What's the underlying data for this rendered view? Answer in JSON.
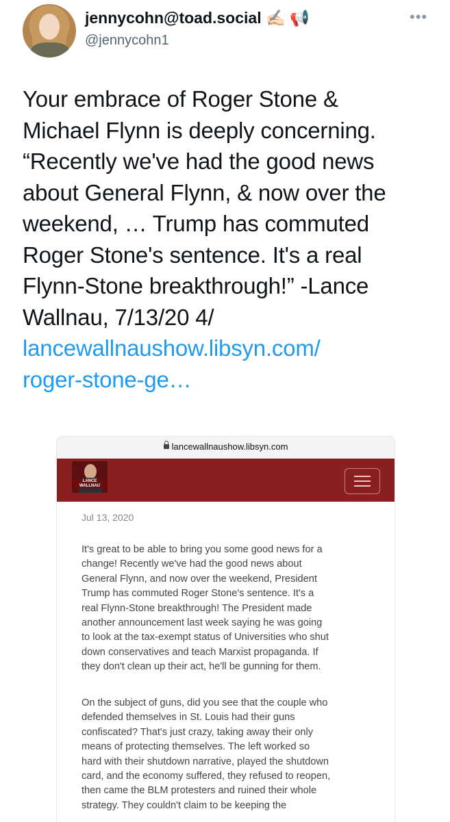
{
  "header": {
    "display_name": "jennycohn@toad.social ✍🏻 📢",
    "handle": "@jennycohn1",
    "more_icon": "ellipsis-icon"
  },
  "tweet": {
    "lines": [
      "Your embrace of Roger Stone &",
      "Michael Flynn is deeply concerning.",
      "“Recently we've had the good news",
      "about General Flynn, & now over the",
      "weekend, … Trump has commuted",
      "Roger Stone's sentence. It's a real",
      "Flynn-Stone breakthrough!” -Lance",
      "Wallnau, 7/13/20 4/"
    ],
    "link_lines": [
      "lancewallnaushow.libsyn.com/",
      "roger-stone-ge…"
    ]
  },
  "screenshot": {
    "url": "lancewallnaushow.libsyn.com",
    "logo_text": "LANCE WALLNAU",
    "date": "Jul 13, 2020",
    "para1": [
      "It's great to be able to bring you some good news for a",
      "change! Recently we've had the good news about",
      "General Flynn, and now over the weekend, President",
      "Trump has commuted Roger Stone's sentence. It's a",
      "real Flynn-Stone breakthrough! The President made",
      "another announcement last week saying he was going",
      "to look at the tax-exempt status of Universities who shut",
      "down conservatives and teach Marxist propaganda. If",
      "they don't clean up their act, he'll be gunning for them."
    ],
    "para2": [
      "On the subject of guns, did you see that the couple who",
      "defended themselves in St. Louis had their guns",
      "confiscated? That's just crazy, taking away their only",
      "means of protecting themselves. The left worked so",
      "hard with their shutdown narrative, played the shutdown",
      "card, and the economy suffered, they refused to reopen,",
      "then came the BLM protesters and ruined their whole",
      "strategy. They couldn't claim to be keeping the"
    ],
    "colors": {
      "banner": "#8a1f1f",
      "link": "#1d9bf0"
    }
  }
}
